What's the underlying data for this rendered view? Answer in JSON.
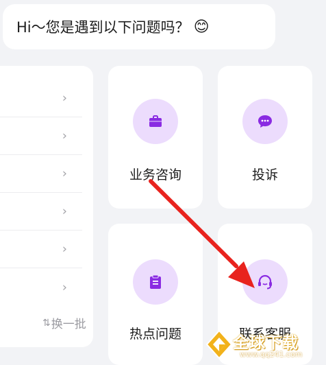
{
  "greeting": {
    "text": "Hi～您是遇到以下问题吗？",
    "emoji": "😊"
  },
  "question_list": {
    "rows": [
      "",
      "",
      "",
      "",
      "",
      ""
    ],
    "refresh_label": "换一批"
  },
  "services": [
    {
      "label": "业务咨询",
      "icon": "briefcase-icon"
    },
    {
      "label": "投诉",
      "icon": "chat-bubble-icon"
    },
    {
      "label": "热点问题",
      "icon": "clipboard-icon"
    },
    {
      "label": "联系客服",
      "icon": "headset-icon"
    }
  ],
  "watermark": {
    "brand": "全球下载",
    "url": "www.qq241.com"
  },
  "colors": {
    "accent": "#8a2be2",
    "icon_bg": "#ecdcfd",
    "annotation_arrow": "#e8231e",
    "watermark_gold": "#f2b21b"
  }
}
